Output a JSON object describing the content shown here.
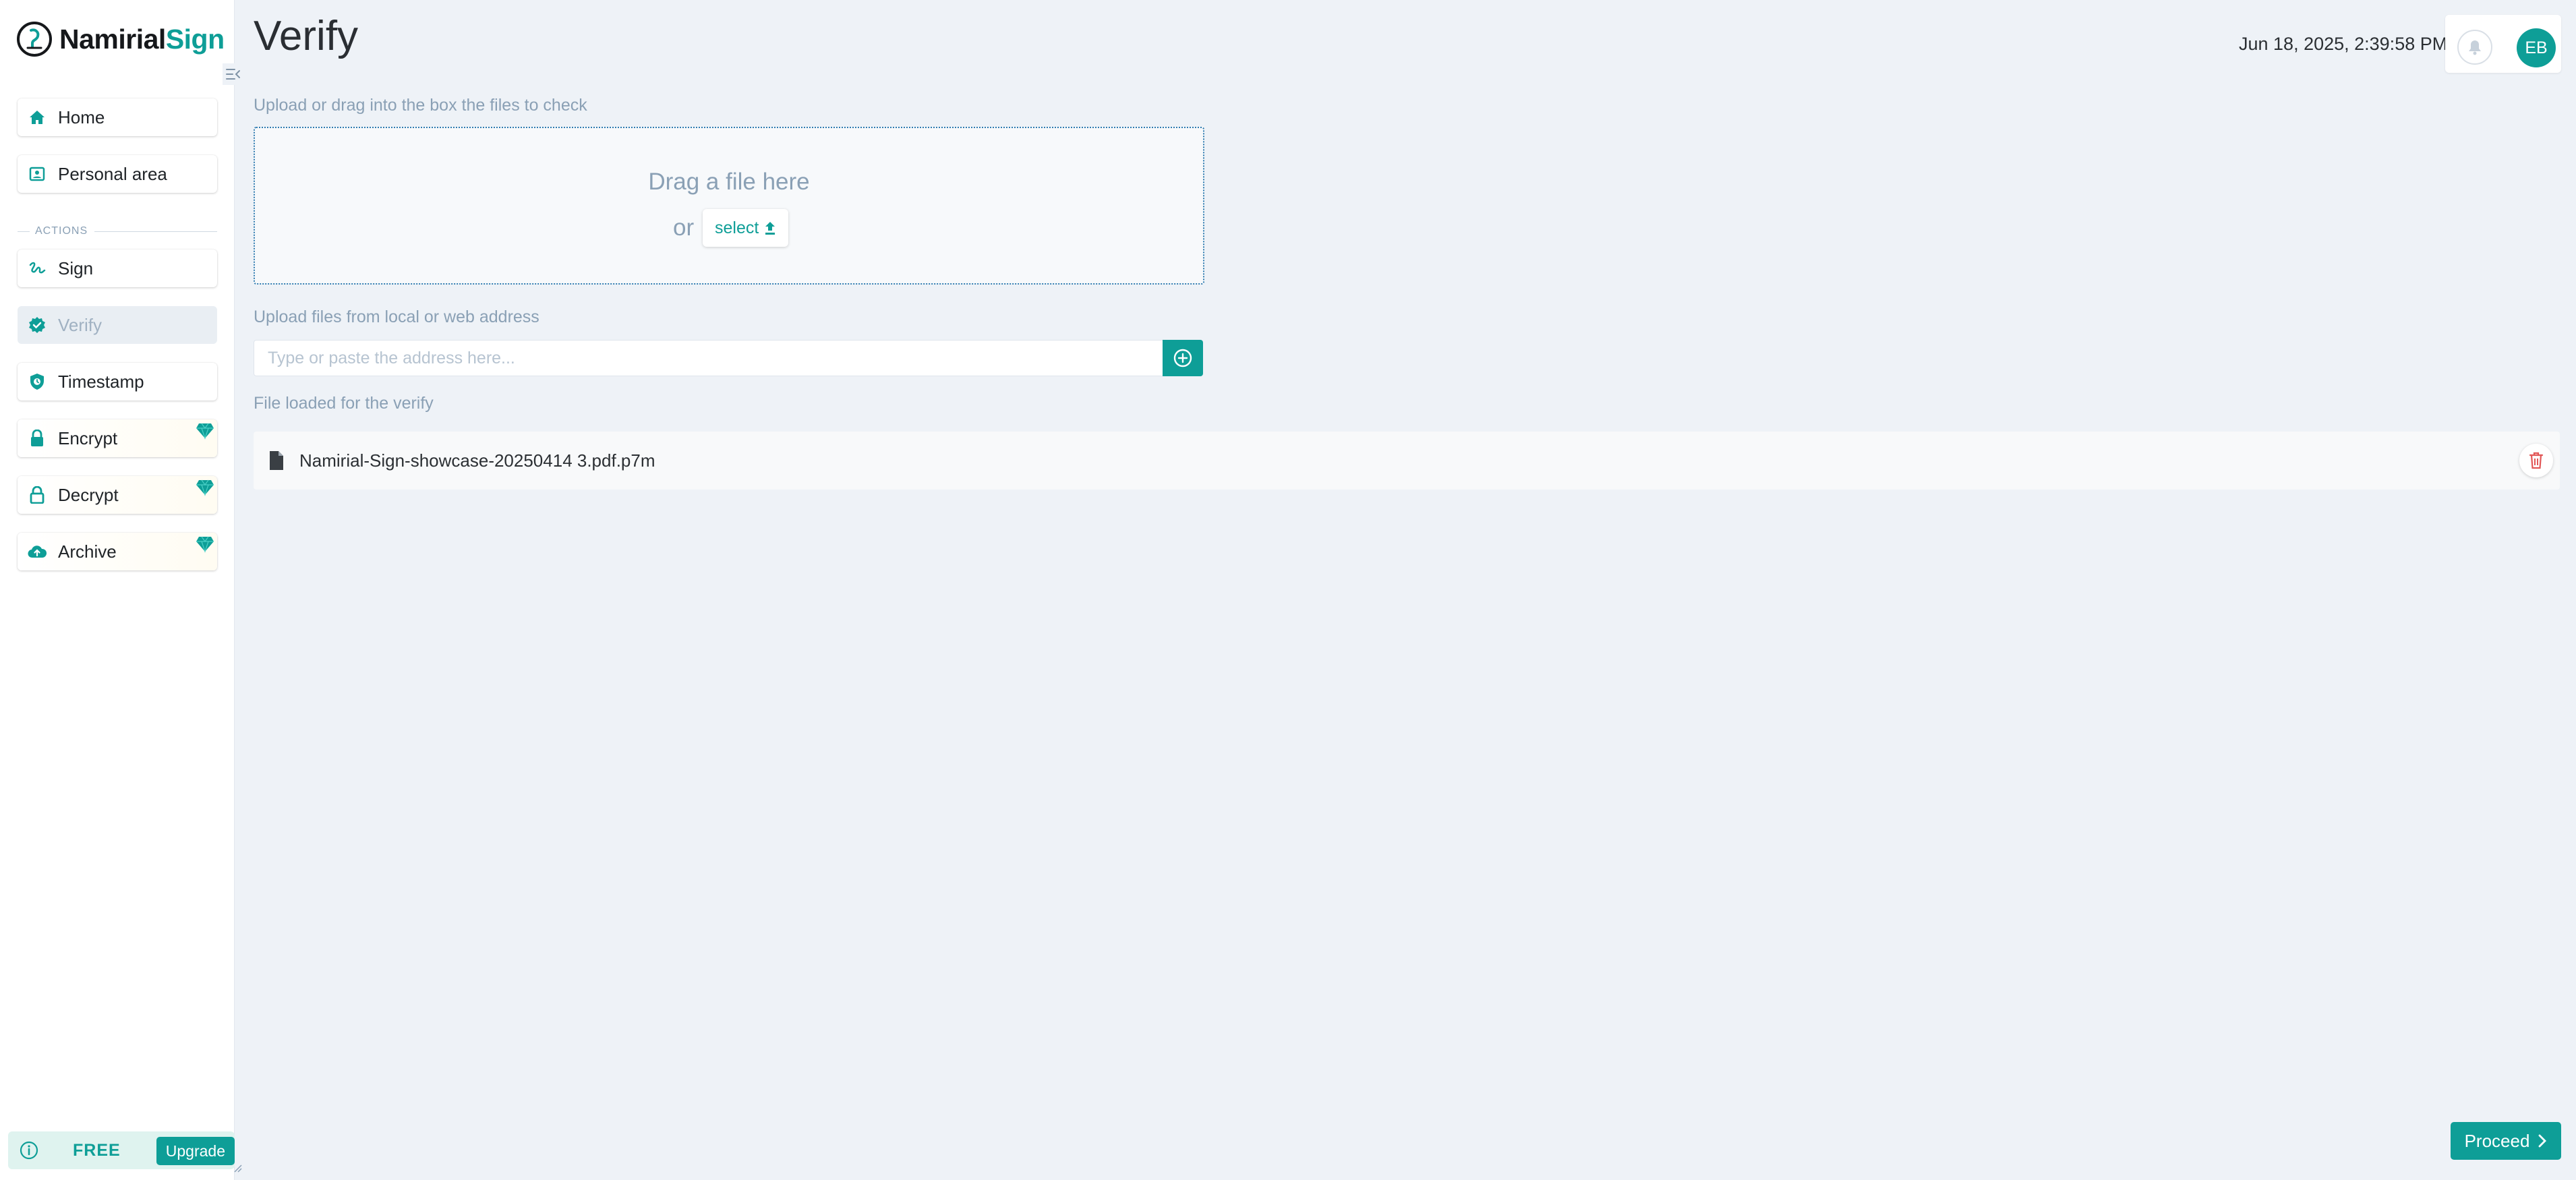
{
  "app": {
    "logo_part1": "Namirial",
    "logo_part2": "Sign",
    "brand_color": "#0e9e97"
  },
  "sidebar": {
    "section_label": "ACTIONS",
    "items": [
      {
        "label": "Home",
        "icon": "home-icon"
      },
      {
        "label": "Personal area",
        "icon": "id-card-icon"
      },
      {
        "label": "Sign",
        "icon": "signature-icon"
      },
      {
        "label": "Verify",
        "icon": "check-badge-icon",
        "active": true
      },
      {
        "label": "Timestamp",
        "icon": "shield-clock-icon"
      },
      {
        "label": "Encrypt",
        "icon": "lock-icon",
        "premium": true
      },
      {
        "label": "Decrypt",
        "icon": "unlock-icon",
        "premium": true
      },
      {
        "label": "Archive",
        "icon": "cloud-upload-icon",
        "premium": true
      }
    ],
    "plan": {
      "label": "FREE",
      "upgrade_label": "Upgrade"
    }
  },
  "header": {
    "title": "Verify",
    "datetime": "Jun 18, 2025, 2:39:58 PM",
    "avatar_initials": "EB"
  },
  "main": {
    "upload_label": "Upload or drag into the box the files to check",
    "dropzone_title": "Drag a file here",
    "dropzone_or": "or",
    "select_label": "select",
    "url_label": "Upload files from local or web address",
    "url_placeholder": "Type or paste the address here...",
    "url_value": "",
    "loaded_label": "File loaded for the verify",
    "files": [
      {
        "name": "Namirial-Sign-showcase-20250414 3.pdf.p7m"
      }
    ],
    "proceed_label": "Proceed"
  }
}
